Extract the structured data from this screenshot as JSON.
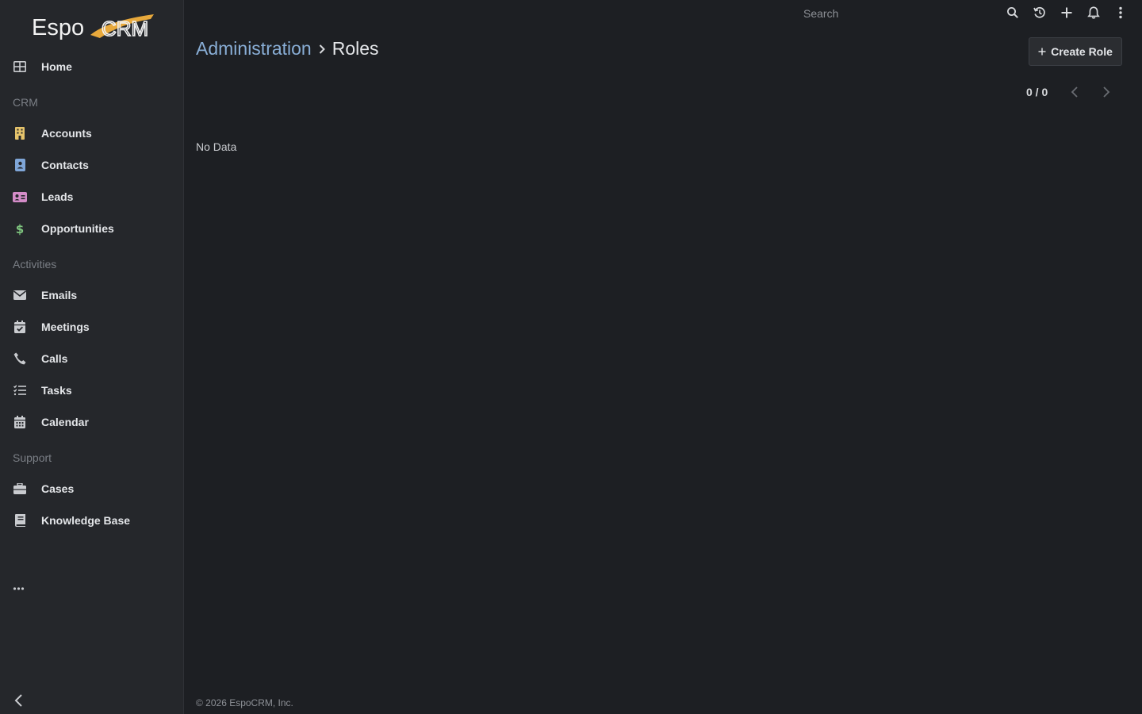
{
  "app": {
    "logo_text": "EspoCRM"
  },
  "sidebar": {
    "home": {
      "label": "Home",
      "icon": "th-large-icon"
    },
    "groups": {
      "crm": "CRM",
      "activities": "Activities",
      "support": "Support"
    },
    "crm_items": [
      {
        "label": "Accounts",
        "icon": "building-icon",
        "color": "#e5c36b"
      },
      {
        "label": "Contacts",
        "icon": "address-card-icon",
        "color": "#7fa6d8"
      },
      {
        "label": "Leads",
        "icon": "id-card-icon",
        "color": "#d48cc8"
      },
      {
        "label": "Opportunities",
        "icon": "dollar-icon",
        "color": "#7ec47e"
      }
    ],
    "activity_items": [
      {
        "label": "Emails",
        "icon": "envelope-icon"
      },
      {
        "label": "Meetings",
        "icon": "calendar-check-icon"
      },
      {
        "label": "Calls",
        "icon": "phone-icon"
      },
      {
        "label": "Tasks",
        "icon": "tasks-icon"
      },
      {
        "label": "Calendar",
        "icon": "calendar-icon"
      }
    ],
    "support_items": [
      {
        "label": "Cases",
        "icon": "briefcase-icon"
      },
      {
        "label": "Knowledge Base",
        "icon": "book-icon"
      }
    ]
  },
  "topbar": {
    "search_placeholder": "Search"
  },
  "header": {
    "breadcrumb_parent": "Administration",
    "breadcrumb_current": "Roles",
    "create_button_label": "Create Role"
  },
  "pager": {
    "count": "0 / 0"
  },
  "content": {
    "empty_text": "No Data"
  },
  "footer": {
    "copyright": "© 2026 EspoCRM, Inc."
  }
}
